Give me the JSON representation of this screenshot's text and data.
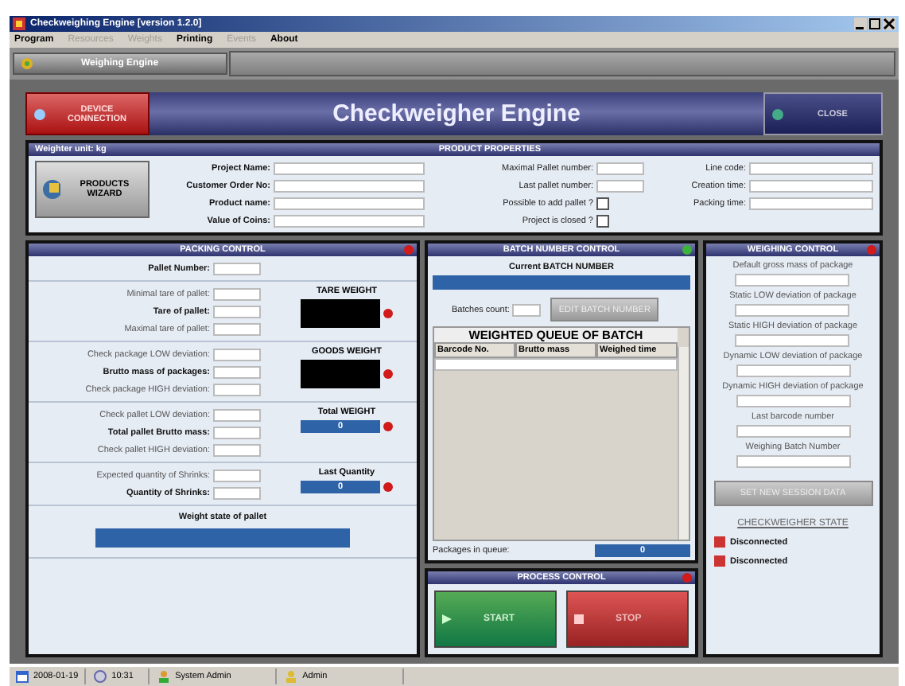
{
  "window": {
    "title": "Checkweighing Engine [version 1.2.0]"
  },
  "menu": [
    {
      "label": "Program",
      "disabled": false
    },
    {
      "label": "Resources",
      "disabled": true
    },
    {
      "label": "Weights",
      "disabled": true
    },
    {
      "label": "Printing",
      "disabled": false
    },
    {
      "label": "Events",
      "disabled": true
    },
    {
      "label": "About",
      "disabled": false
    }
  ],
  "toolbar": {
    "tabs": [
      {
        "label": "Weighing Engine",
        "selected": true
      }
    ]
  },
  "header": {
    "connect_button": "DEVICE CONNECTION",
    "title": "Checkweigher Engine",
    "close_button": "CLOSE"
  },
  "product": {
    "unit_label": "Weighter unit: kg",
    "title": "PRODUCT PROPERTIES",
    "wizard_button": "PRODUCTS WIZARD",
    "fields_left": [
      {
        "label": "Project Name:"
      },
      {
        "label": "Customer Order No:"
      },
      {
        "label": "Product name:"
      },
      {
        "label": "Value of Coins:"
      }
    ],
    "fields_middle": [
      {
        "label": "Maximal Pallet number:",
        "kind": "input"
      },
      {
        "label": "Last pallet number:",
        "kind": "input"
      },
      {
        "label": "Possible to add pallet ?",
        "kind": "checkbox",
        "checked": false
      },
      {
        "label": "Project is closed ?",
        "kind": "checkbox",
        "checked": false
      }
    ],
    "fields_right": [
      {
        "label": "Line code:"
      },
      {
        "label": "Creation time:"
      },
      {
        "label": "Packing time:"
      }
    ]
  },
  "packing": {
    "title": "PACKING CONTROL",
    "color": "#d11a1a",
    "pallet_label": "Pallet Number:",
    "groups": [
      {
        "fields": [
          {
            "label": "Minimal tare of pallet:",
            "bold": false
          },
          {
            "label": "Tare of pallet:",
            "bold": true
          },
          {
            "label": "Maximal tare of pallet:",
            "bold": false
          }
        ],
        "display": {
          "title": "TARE WEIGHT",
          "kind": "dark",
          "color": "#d11a1a"
        }
      },
      {
        "fields": [
          {
            "label": "Check package LOW deviation:",
            "bold": false
          },
          {
            "label": "Brutto mass of packages:",
            "bold": true
          },
          {
            "label": "Check package HIGH deviation:",
            "bold": false
          }
        ],
        "display": {
          "title": "GOODS WEIGHT",
          "kind": "dark",
          "color": "#d11a1a"
        }
      },
      {
        "fields": [
          {
            "label": "Check pallet LOW deviation:",
            "bold": false
          },
          {
            "label": "Total pallet Brutto mass:",
            "bold": true
          },
          {
            "label": "Check pallet HIGH deviation:",
            "bold": false
          }
        ],
        "display": {
          "title": "Total WEIGHT",
          "kind": "value",
          "value": "0",
          "color": "#d11a1a"
        }
      },
      {
        "fields": [
          {
            "label": "Expected quantity of Shrinks:",
            "bold": false
          },
          {
            "label": "Quantity of Shrinks:",
            "bold": true
          }
        ],
        "display": {
          "title": "Last Quantity",
          "kind": "value",
          "value": "0",
          "color": "#d11a1a"
        }
      }
    ],
    "weight_state_label": "Weight state of pallet"
  },
  "batch": {
    "title": "BATCH NUMBER CONTROL",
    "color": "#3cb43c",
    "current_label": "Current BATCH NUMBER",
    "count_label": "Batches count:",
    "edit_button": {
      "label": "EDIT BATCH NUMBER",
      "disabled": true
    },
    "queue_title": "WEIGHTED QUEUE OF BATCH",
    "columns": [
      "Barcode No.",
      "Brutto mass",
      "Weighed time"
    ],
    "queue_label": "Packages in queue:",
    "queue_value": "0"
  },
  "process": {
    "title": "PROCESS CONTROL",
    "color": "#d11a1a",
    "start_button": "START",
    "stop_button": "STOP"
  },
  "weighing": {
    "title": "WEIGHING CONTROL",
    "color": "#d11a1a",
    "fields": [
      {
        "label": "Default gross mass of package"
      },
      {
        "label": "Static LOW deviation of package"
      },
      {
        "label": "Static HIGH deviation of package"
      },
      {
        "label": "Dynamic LOW deviation of package"
      },
      {
        "label": "Dynamic HIGH deviation of package"
      },
      {
        "label": "Last barcode number"
      },
      {
        "label": "Weighing Batch Number"
      }
    ],
    "session_button": {
      "label": "SET NEW SESSION DATA",
      "disabled": true
    },
    "state_title": "CHECKWEIGHER STATE",
    "states": [
      {
        "label": "Disconnected",
        "connected": false
      },
      {
        "label": "Disconnected",
        "connected": false
      }
    ]
  },
  "status_bar": [
    {
      "text": "2008-01-19",
      "kind": "date"
    },
    {
      "text": "10:31",
      "kind": "time"
    },
    {
      "text": "System Admin",
      "kind": "user"
    },
    {
      "text": "Admin",
      "kind": "role"
    }
  ]
}
